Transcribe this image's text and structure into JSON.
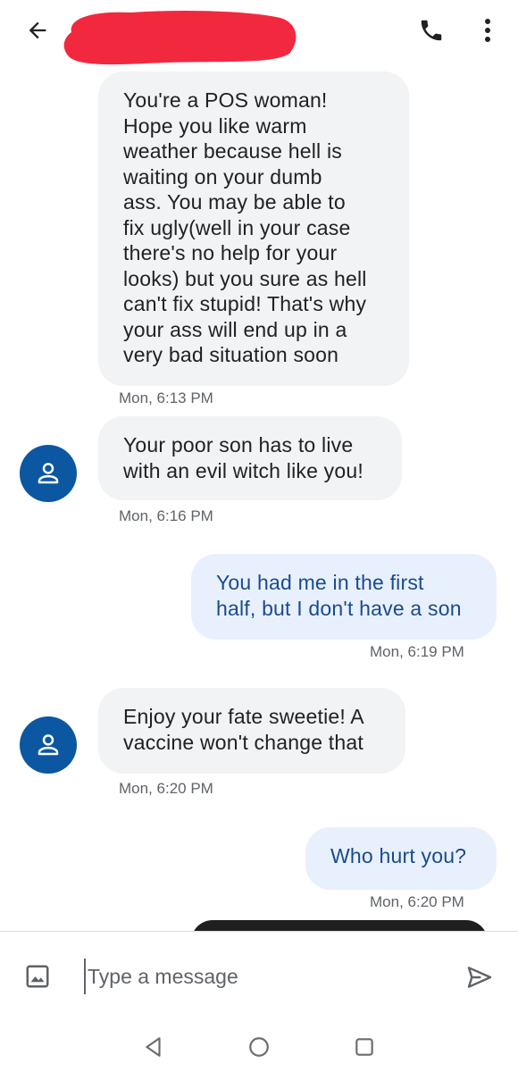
{
  "header": {
    "back_icon": "arrow-back-icon",
    "phone_icon": "phone-icon",
    "more_icon": "more-vert-icon",
    "redaction_color": "#f2283f"
  },
  "messages": [
    {
      "direction": "incoming",
      "show_avatar": false,
      "text": "You're a POS woman!\nHope you like warm\nweather because hell is\nwaiting on your dumb\nass. You may be able to\nfix ugly(well in your case\nthere's no help for your\nlooks) but you sure as hell\ncan't fix stupid! That's why\nyour ass will end up in a\nvery bad situation soon",
      "time": "Mon, 6:13 PM"
    },
    {
      "direction": "incoming",
      "show_avatar": true,
      "text": "Your poor son has to live\nwith an evil witch like you!",
      "time": "Mon, 6:16 PM"
    },
    {
      "direction": "outgoing",
      "text": "You had me in the first\nhalf, but I don't have a son",
      "time": "Mon, 6:19 PM"
    },
    {
      "direction": "incoming",
      "show_avatar": true,
      "text": "Enjoy your fate sweetie! A\nvaccine won't change that",
      "time": "Mon, 6:20 PM"
    },
    {
      "direction": "outgoing",
      "text": "Who hurt you?",
      "time": "Mon, 6:20 PM"
    }
  ],
  "compose": {
    "placeholder": "Type a message",
    "attach_icon": "image-icon",
    "send_icon": "send-icon"
  },
  "navbar": {
    "back_icon": "nav-back-icon",
    "home_icon": "nav-home-icon",
    "recents_icon": "nav-recents-icon"
  },
  "colors": {
    "incoming_bubble": "#f1f3f4",
    "outgoing_bubble": "#e8f0fe",
    "outgoing_text": "#1a4b8c",
    "avatar": "#0b57a1"
  }
}
